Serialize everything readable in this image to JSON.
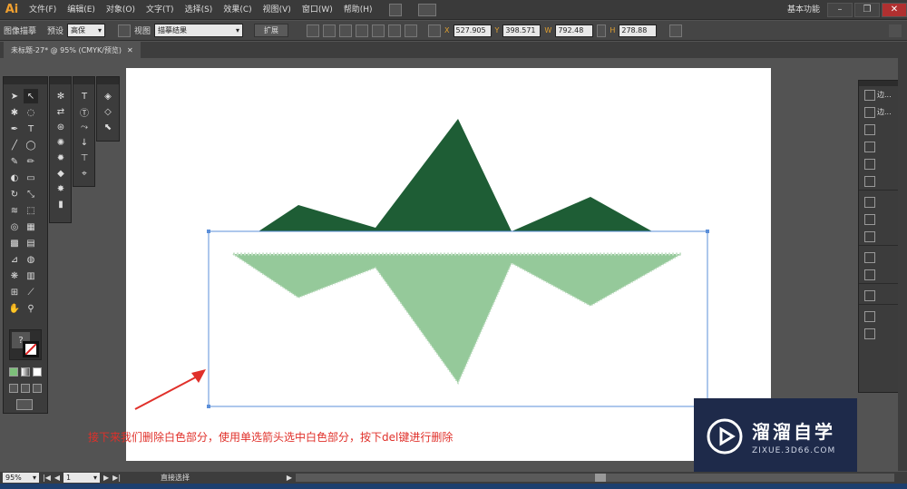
{
  "app": {
    "logo": "Ai",
    "menus": [
      "文件(F)",
      "编辑(E)",
      "对象(O)",
      "文字(T)",
      "选择(S)",
      "效果(C)",
      "视图(V)",
      "窗口(W)",
      "帮助(H)"
    ],
    "workspace": "基本功能"
  },
  "control": {
    "title": "图像描摹",
    "preset_label": "预设",
    "preset_value": "高保",
    "view_label": "视图",
    "view_value": "描摹结果",
    "expand_label": "扩展",
    "x_value": "527.905",
    "y_value": "398.571",
    "w_value": "792.48",
    "h_value": "278.88"
  },
  "document": {
    "tab_title": "未标题-27* @ 95% (CMYK/预览)"
  },
  "tools": {
    "text_tool": "T",
    "help": "?"
  },
  "right_panel": {
    "item_label": "边..."
  },
  "status": {
    "zoom": "95%",
    "page": "1",
    "tool_name": "直接选择"
  },
  "annotation": {
    "instruction": "接下来我们删除白色部分，使用单选箭头选中白色部分，按下del键进行删除"
  },
  "watermark": {
    "title": "溜溜自学",
    "url": "ZIXUE.3D66.COM"
  },
  "colors": {
    "mountain_dark": "#1e5d35",
    "mountain_light": "#95c99a",
    "annotation_red": "#e0302a",
    "selection_blue": "#5b8fd9",
    "watermark_bg": "#1e2a4a"
  }
}
